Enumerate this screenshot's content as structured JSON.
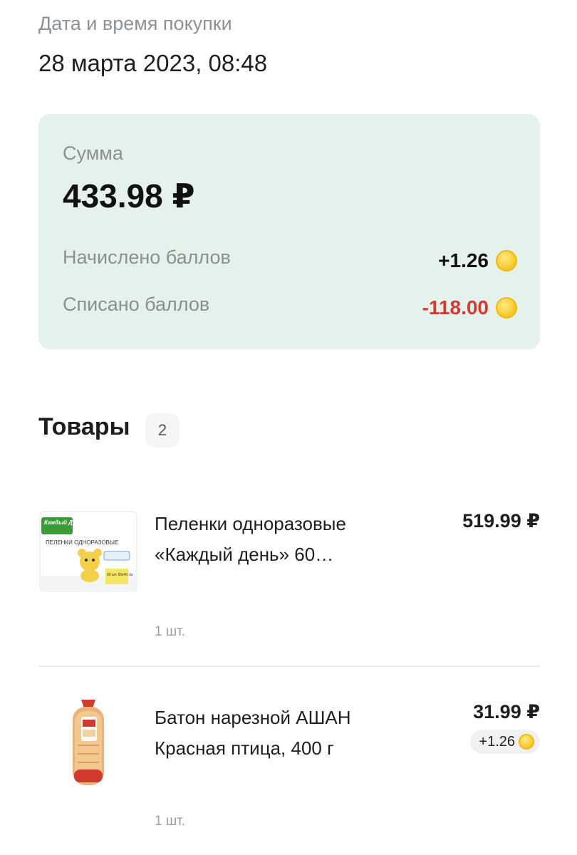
{
  "purchase": {
    "date_label": "Дата и время покупки",
    "date_value": "28 марта 2023, 08:48"
  },
  "summary": {
    "sum_label": "Сумма",
    "sum_value": "433.98 ₽",
    "accrued_label": "Начислено баллов",
    "accrued_value": "+1.26",
    "spent_label": "Списано баллов",
    "spent_value": "-118.00",
    "coin_icon": "coin-icon",
    "colors": {
      "card_bg": "#e5f2ec",
      "negative": "#d23a33",
      "coin": "#f7cd2c"
    }
  },
  "goods": {
    "title": "Товары",
    "count": "2",
    "items": [
      {
        "name": "Пеленки одноразовые «Каждый день» 60…",
        "qty": "1 шт.",
        "price": "519.99 ₽",
        "image": "diapers-package",
        "image_brand_text": "Каждый День",
        "image_product_text": "ПЕЛЕНКИ ОДНОРАЗОВЫЕ",
        "image_size_text": "60 шт. 60х40 см"
      },
      {
        "name": "Батон нарезной АШАН Красная птица, 400 г",
        "qty": "1 шт.",
        "price": "31.99 ₽",
        "bonus": "+1.26",
        "image": "bread-loaf"
      }
    ]
  }
}
